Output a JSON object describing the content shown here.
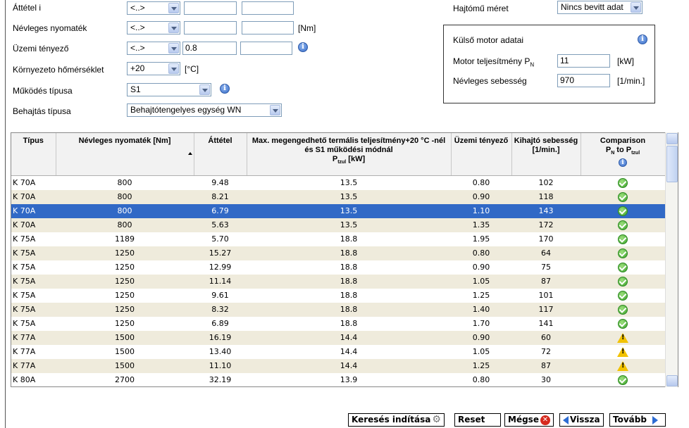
{
  "form": {
    "attetel_label": "Áttétel i",
    "attetel_select": "<..>",
    "nyomatek_label": "Névleges nyomaték",
    "nyomatek_select": "<..>",
    "nyomatek_unit": "[Nm]",
    "tenyezo_label": "Üzemi tényező",
    "tenyezo_select": "<..>",
    "tenyezo_value": "0.8",
    "homerseklet_label": "Környezeto hőmérséklet",
    "homerseklet_value": "+20",
    "homerseklet_unit": "[°C]",
    "mukodes_label": "Működés típusa",
    "mukodes_value": "S1",
    "behajtas_label": "Behajtás típusa",
    "behajtas_value": "Behajtótengelyes egység WN",
    "hajtomu_label": "Hajtómű méret",
    "hajtomu_value": "Nincs bevitt adat"
  },
  "motor_panel": {
    "title": "Külső motor adatai",
    "power_label": "Motor teljesítmény P",
    "power_sub": "N",
    "power_value": "11",
    "power_unit": "[kW]",
    "speed_label": "Névleges sebesség",
    "speed_value": "970",
    "speed_unit": "[1/min.]"
  },
  "table": {
    "headers": {
      "tipus": "Típus",
      "nyomatek": "Névleges nyomaték [Nm]",
      "attetel": "Áttétel",
      "max_line1": "Max. megengedhető termális teljesítmény+20 °C -nél és S1 működési módnál",
      "max_p": "P",
      "max_sub": "tzul",
      "max_unit": " [kW]",
      "uzemi": "Üzemi tényező",
      "kihajto": "Kihajtó sebesség [1/min.]",
      "comp_line1": "Comparison",
      "comp_p": "P",
      "comp_psub": "N",
      "comp_to": " to P",
      "comp_tsub": "tzul"
    },
    "rows": [
      {
        "tipus": "K 70A",
        "nyomatek": "800",
        "attetel": "9.48",
        "max": "13.5",
        "uzemi": "0.80",
        "kihajto": "102",
        "status": "ok"
      },
      {
        "tipus": "K 70A",
        "nyomatek": "800",
        "attetel": "8.21",
        "max": "13.5",
        "uzemi": "0.90",
        "kihajto": "118",
        "status": "ok"
      },
      {
        "tipus": "K 70A",
        "nyomatek": "800",
        "attetel": "6.79",
        "max": "13.5",
        "uzemi": "1.10",
        "kihajto": "143",
        "status": "ok"
      },
      {
        "tipus": "K 70A",
        "nyomatek": "800",
        "attetel": "5.63",
        "max": "13.5",
        "uzemi": "1.35",
        "kihajto": "172",
        "status": "ok"
      },
      {
        "tipus": "K 75A",
        "nyomatek": "1189",
        "attetel": "5.70",
        "max": "18.8",
        "uzemi": "1.95",
        "kihajto": "170",
        "status": "ok"
      },
      {
        "tipus": "K 75A",
        "nyomatek": "1250",
        "attetel": "15.27",
        "max": "18.8",
        "uzemi": "0.80",
        "kihajto": "64",
        "status": "ok"
      },
      {
        "tipus": "K 75A",
        "nyomatek": "1250",
        "attetel": "12.99",
        "max": "18.8",
        "uzemi": "0.90",
        "kihajto": "75",
        "status": "ok"
      },
      {
        "tipus": "K 75A",
        "nyomatek": "1250",
        "attetel": "11.14",
        "max": "18.8",
        "uzemi": "1.05",
        "kihajto": "87",
        "status": "ok"
      },
      {
        "tipus": "K 75A",
        "nyomatek": "1250",
        "attetel": "9.61",
        "max": "18.8",
        "uzemi": "1.25",
        "kihajto": "101",
        "status": "ok"
      },
      {
        "tipus": "K 75A",
        "nyomatek": "1250",
        "attetel": "8.32",
        "max": "18.8",
        "uzemi": "1.40",
        "kihajto": "117",
        "status": "ok"
      },
      {
        "tipus": "K 75A",
        "nyomatek": "1250",
        "attetel": "6.89",
        "max": "18.8",
        "uzemi": "1.70",
        "kihajto": "141",
        "status": "ok"
      },
      {
        "tipus": "K 77A",
        "nyomatek": "1500",
        "attetel": "16.19",
        "max": "14.4",
        "uzemi": "0.90",
        "kihajto": "60",
        "status": "warn"
      },
      {
        "tipus": "K 77A",
        "nyomatek": "1500",
        "attetel": "13.40",
        "max": "14.4",
        "uzemi": "1.05",
        "kihajto": "72",
        "status": "warn"
      },
      {
        "tipus": "K 77A",
        "nyomatek": "1500",
        "attetel": "11.10",
        "max": "14.4",
        "uzemi": "1.25",
        "kihajto": "87",
        "status": "warn"
      },
      {
        "tipus": "K 80A",
        "nyomatek": "2700",
        "attetel": "32.19",
        "max": "13.9",
        "uzemi": "0.80",
        "kihajto": "30",
        "status": "ok"
      }
    ],
    "selected_index": 2
  },
  "buttons": {
    "search": "Keresés indítása",
    "reset": "Reset",
    "cancel": "Mégse",
    "back": "Vissza",
    "next": "Tovább"
  },
  "colors": {
    "selected_row": "#3169c6",
    "alt_row": "#efebdc",
    "ok_icon": "#3aa22a",
    "warn_icon": "#f2c200"
  }
}
